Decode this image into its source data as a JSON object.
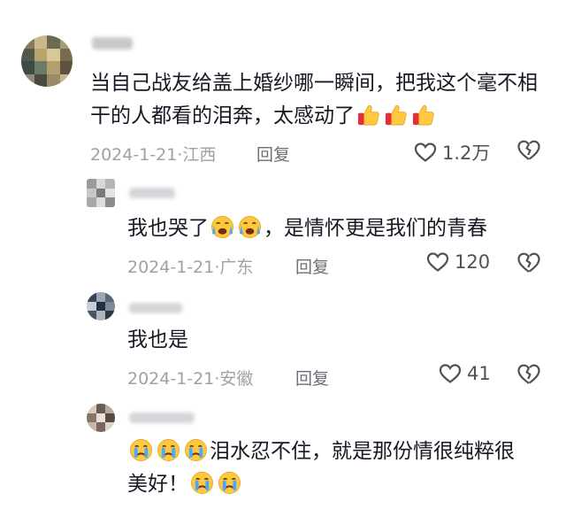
{
  "comments": [
    {
      "username": "",
      "text": "当自己战友给盖上婚纱哪一瞬间，把我这个毫不相干的人都看的泪奔，太感动了",
      "emojis": [
        "thumbs-up",
        "thumbs-up",
        "thumbs-up"
      ],
      "date": "2024-1-21",
      "location": "江西",
      "reply_label": "回复",
      "likes": "1.2万"
    },
    {
      "username": "",
      "text": "我也哭了",
      "text_emojis": [
        "loudly-crying",
        "loudly-crying"
      ],
      "text_after": "，是情怀更是我们的青春",
      "date": "2024-1-21",
      "location": "广东",
      "reply_label": "回复",
      "likes": "120"
    },
    {
      "username": "",
      "text": "我也是",
      "date": "2024-1-21",
      "location": "安徽",
      "reply_label": "回复",
      "likes": "41"
    },
    {
      "username": "",
      "lead_emojis": [
        "crying-face",
        "crying-face",
        "crying-face"
      ],
      "text": "泪水忍不住，就是那份情很纯粹很",
      "text_line2": "美好！",
      "trail_emojis": [
        "crying-face",
        "crying-face"
      ]
    }
  ],
  "colors": {
    "text": "#161823",
    "meta": "#a0a0a6",
    "reply": "#6e6e76",
    "emoji_yellow": "#ffc83d",
    "thumb_cuff": "#e0303c"
  }
}
